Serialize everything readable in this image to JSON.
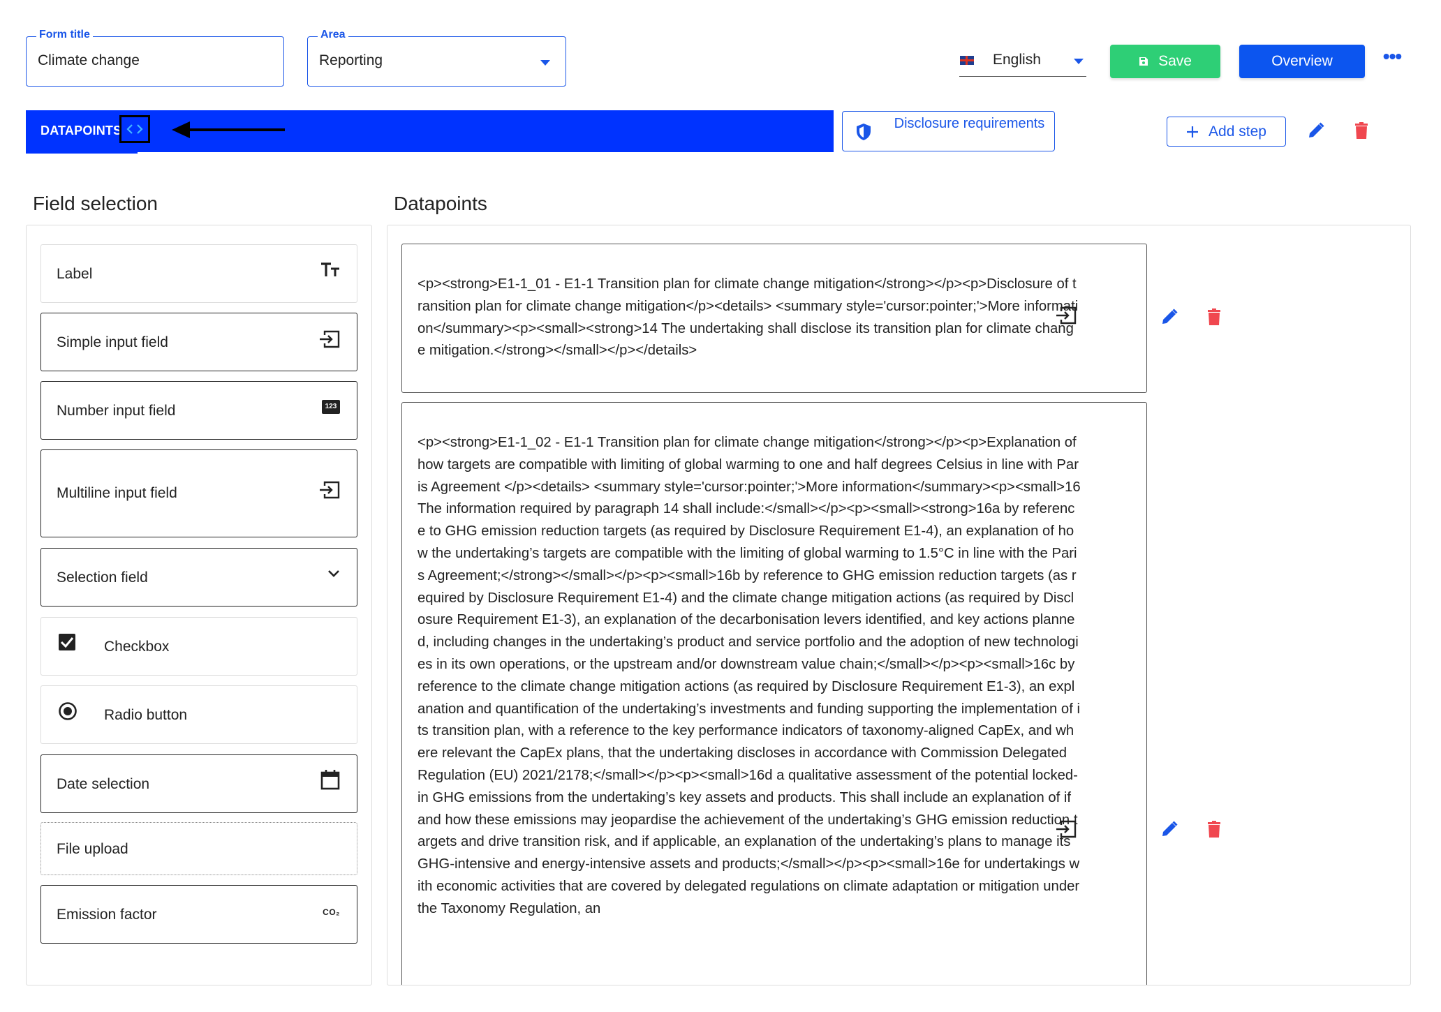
{
  "header": {
    "form_title_legend": "Form title",
    "form_title_value": "Climate change",
    "area_legend": "Area",
    "area_value": "Reporting",
    "language": "English",
    "save_label": "Save",
    "overview_label": "Overview",
    "more_label": "•••"
  },
  "stepbar": {
    "step_label": "DATAPOINTS",
    "code_glyph": "‹›",
    "disclosure_label": "Disclosure requirements",
    "add_step_label": "Add step"
  },
  "headings": {
    "field_selection": "Field selection",
    "datapoints": "Datapoints"
  },
  "field_types": [
    {
      "label": "Label",
      "icon": "text-size-icon"
    },
    {
      "label": "Simple input field",
      "icon": "input-icon"
    },
    {
      "label": "Number input field",
      "icon": "number-123-icon",
      "icon_text": "123"
    },
    {
      "label": "Multiline input field",
      "icon": "input-icon"
    },
    {
      "label": "Selection field",
      "icon": "chevron-down-icon"
    },
    {
      "label": "Checkbox",
      "icon": "checkbox-checked-icon"
    },
    {
      "label": "Radio button",
      "icon": "radio-selected-icon"
    },
    {
      "label": "Date selection",
      "icon": "calendar-icon"
    },
    {
      "label": "File upload",
      "icon": ""
    },
    {
      "label": "Emission factor",
      "icon": "co2-icon",
      "icon_text": "CO₂"
    }
  ],
  "datapoints": [
    {
      "text": "<p><strong>E1-1_01 - E1-1 Transition plan for climate change mitigation</strong></p><p>Disclosure of transition plan for climate change mitigation</p><details> <summary style='cursor:pointer;'>More information</summary><p><small><strong>14 The undertaking shall disclose its transition plan for climate change mitigation.</strong></small></p></details>"
    },
    {
      "text": "<p><strong>E1-1_02 - E1-1 Transition plan for climate change mitigation</strong></p><p>Explanation of how targets are compatible with limiting of global warming to one and half degrees Celsius in line with Paris Agreement </p><details> <summary style='cursor:pointer;'>More information</summary><p><small>16 The information required by paragraph 14 shall include:</small></p><p><small><strong>16a by reference to GHG emission reduction targets (as required by Disclosure Requirement E1-4), an explanation of how the undertaking’s targets are compatible with the limiting of global warming to 1.5°C in line with the Paris Agreement;</strong></small></p><p><small>16b by reference to GHG emission reduction targets (as required by Disclosure Requirement E1-4) and the climate change mitigation actions (as required by Disclosure Requirement E1-3), an explanation of the decarbonisation levers identified, and key actions planned, including changes in the undertaking’s product and service portfolio and the adoption of new technologies in its own operations, or the upstream and/or downstream value chain;</small></p><p><small>16c by reference to the climate change mitigation actions (as required by Disclosure Requirement E1-3), an explanation and quantification of the undertaking’s investments and funding supporting the implementation of its transition plan, with a reference to the key performance indicators of taxonomy-aligned CapEx, and where relevant the CapEx plans, that the undertaking discloses in accordance with Commission Delegated Regulation (EU) 2021/2178;</small></p><p><small>16d a qualitative assessment of the potential locked-in GHG emissions from the undertaking’s key assets and products. This shall include an explanation of if and how these emissions may jeopardise the achievement of the undertaking’s GHG emission reduction targets and drive transition risk, and if applicable, an explanation of the undertaking’s plans to manage its GHG-intensive and energy-intensive assets and products;</small></p><p><small>16e for undertakings with economic activities that are covered by delegated regulations on climate adaptation or mitigation under the Taxonomy Regulation, an"
    }
  ],
  "colors": {
    "primary": "#0c55ef",
    "stepbar": "#0033ff",
    "save": "#2ecf76",
    "delete": "#f0474f"
  }
}
